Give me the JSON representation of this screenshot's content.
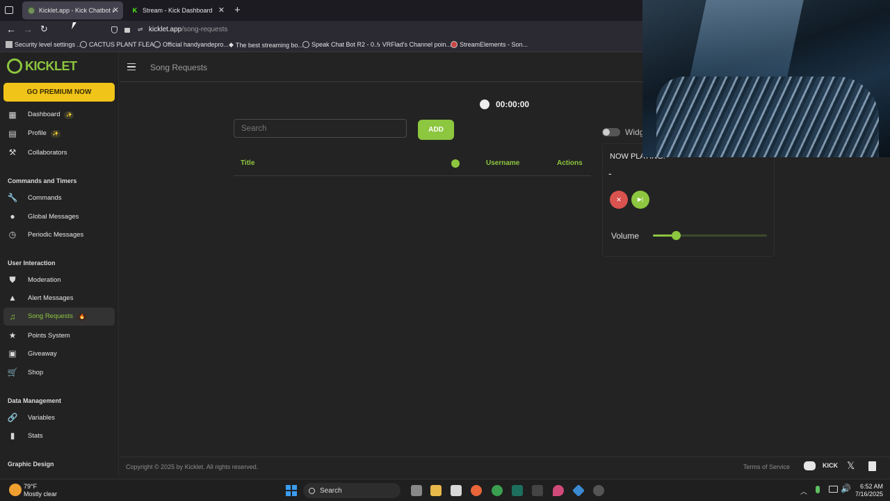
{
  "browser": {
    "tabs": [
      {
        "title": "Kicklet.app - Kick Chatbot and C",
        "active": true
      },
      {
        "title": "Stream - Kick Dashboard",
        "active": false
      }
    ],
    "url_domain": "kicklet.app",
    "url_path": "/song-requests",
    "bookmarks": [
      "Security level settings ...",
      "CACTUS PLANT FLEA ...",
      "Official handyandepro...",
      "The best streaming bo...",
      "Speak Chat Bot R2 - 0...",
      "VRFlad's Channel poin...",
      "StreamElements - Son..."
    ]
  },
  "app": {
    "logo": "KICKLET",
    "premium_button": "GO PREMIUM NOW",
    "page_title": "Song Requests",
    "accent": "#8dc63f",
    "sidebar": {
      "top_items": [
        {
          "label": "Dashboard",
          "badge": "✨"
        },
        {
          "label": "Profile",
          "badge": "✨"
        },
        {
          "label": "Collaborators"
        }
      ],
      "sections": [
        {
          "title": "Commands and Timers",
          "items": [
            "Commands",
            "Global Messages",
            "Periodic Messages"
          ]
        },
        {
          "title": "User Interaction",
          "items": [
            "Moderation",
            "Alert Messages",
            "Song Requests",
            "Points System",
            "Giveaway",
            "Shop"
          ]
        },
        {
          "title": "Data Management",
          "items": [
            "Variables",
            "Stats"
          ]
        },
        {
          "title": "Graphic Design",
          "items": []
        }
      ],
      "active_badge": "🔥"
    },
    "timer": "00:00:00",
    "search_placeholder": "Search",
    "add_button": "ADD",
    "widget_label": "Widg",
    "table": {
      "columns": [
        "Title",
        "Username",
        "Actions"
      ]
    },
    "player": {
      "now_playing_label": "NOW PLAYING:",
      "current_track": "-",
      "volume_label": "Volume",
      "volume": 0.2
    },
    "footer": {
      "copyright": "Copyright © 2025 by Kicklet. All rights reserved.",
      "terms": "Terms of Service"
    }
  },
  "taskbar": {
    "weather_temp": "79°F",
    "weather_desc": "Mostly clear",
    "search_label": "Search",
    "time": "6:52 AM",
    "date": "7/16/2025"
  }
}
